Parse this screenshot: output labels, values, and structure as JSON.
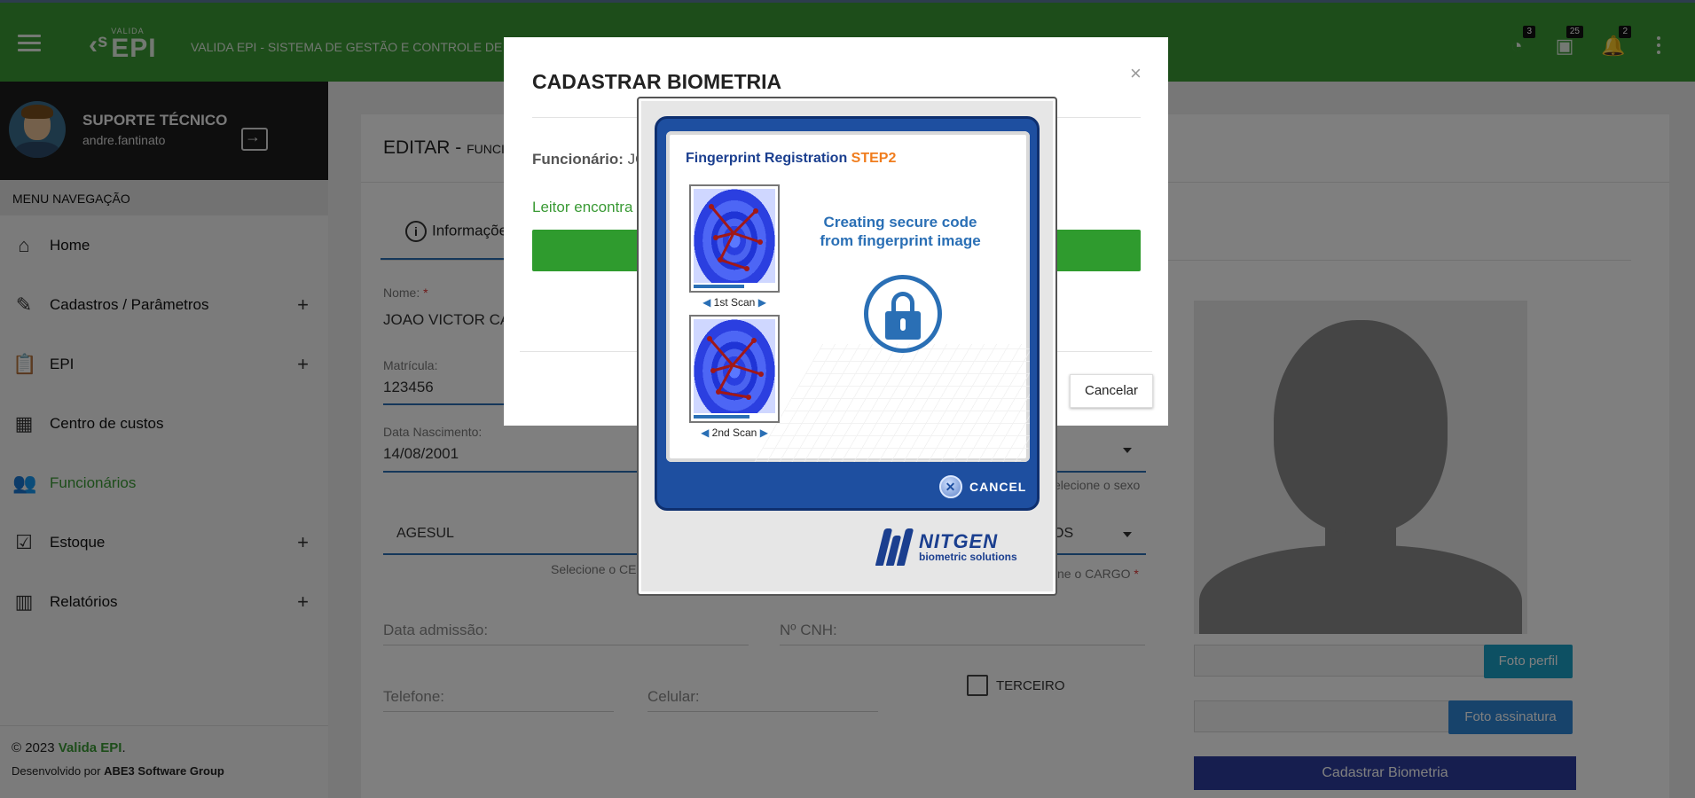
{
  "header": {
    "logo_small": "VALIDA",
    "logo_big": "EPI",
    "title": "VALIDA EPI - SISTEMA DE GESTÃO E CONTROLE DE EPI",
    "badges": {
      "history": "3",
      "alerts": "25",
      "notifications": "2"
    }
  },
  "sidebar": {
    "user_name": "SUPORTE TÉCNICO",
    "user_login": "andre.fantinato",
    "menu_header": "MENU NAVEGAÇÃO",
    "items": [
      {
        "label": "Home",
        "icon": "home-icon",
        "expandable": false
      },
      {
        "label": "Cadastros / Parâmetros",
        "icon": "pencil-icon",
        "expandable": true
      },
      {
        "label": "EPI",
        "icon": "clipboard-icon",
        "expandable": true
      },
      {
        "label": "Centro de custos",
        "icon": "building-icon",
        "expandable": false
      },
      {
        "label": "Funcionários",
        "icon": "people-icon",
        "expandable": false,
        "active": true
      },
      {
        "label": "Estoque",
        "icon": "clipboard-check-icon",
        "expandable": true
      },
      {
        "label": "Relatórios",
        "icon": "bar-chart-icon",
        "expandable": true
      }
    ],
    "plus": "+",
    "footer_copyright": "© 2023 ",
    "footer_brand": "Valida EPI",
    "footer_dot": ".",
    "footer_dev_prefix": "Desenvolvido por ",
    "footer_dev_company": "ABE3 Software Group"
  },
  "main": {
    "title": "EDITAR - ",
    "title_small": "FUNCIONÁRIO",
    "tab_info": "Informações",
    "nome_label": "Nome:",
    "nome_value": "JOAO VICTOR CA",
    "matricula_label": "Matrícula:",
    "matricula_value": "123456",
    "nascimento_label": "Data Nascimento:",
    "nascimento_value": "14/08/2001",
    "sexo_hint": "elecione o sexo",
    "centro_value": "AGESUL",
    "centro_hint": "Selecione o CE",
    "cargo_value": "OS",
    "cargo_hint": "ne o CARGO",
    "admissao_label": "Data admissão:",
    "cnh_label": "Nº CNH:",
    "telefone_label": "Telefone:",
    "celular_label": "Celular:",
    "terceiro_label": "TERCEIRO",
    "foto_perfil": "Foto perfil",
    "foto_assinatura": "Foto assinatura",
    "cadastrar_biometria": "Cadastrar Biometria"
  },
  "modal": {
    "title": "CADASTRAR BIOMETRIA",
    "close": "×",
    "func_label": "Funcionário:",
    "func_value": " JO",
    "message": "Leitor encontra",
    "cancel": "Cancelar"
  },
  "nitgen": {
    "title": "Fingerprint Registration ",
    "step": "STEP2",
    "scan1": "1st Scan",
    "scan2": "2nd Scan",
    "scan1_progress": 0.62,
    "scan2_progress": 0.68,
    "message": "Creating secure code from fingerprint image",
    "cancel": "CANCEL",
    "brand": "NITGEN",
    "brand_sub": "biometric solutions"
  }
}
